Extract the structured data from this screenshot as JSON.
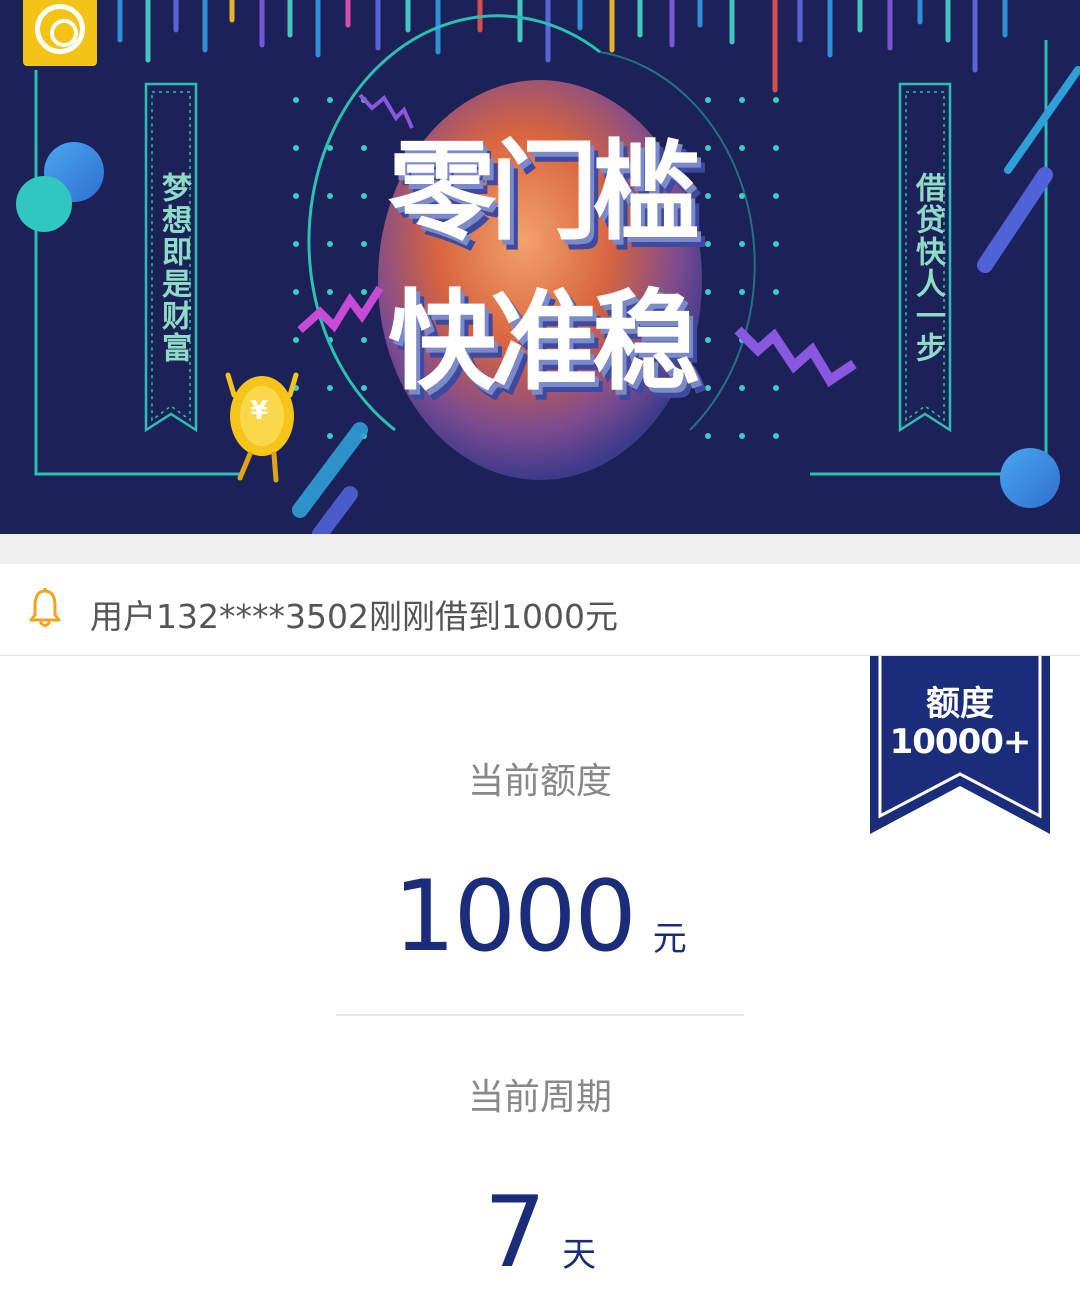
{
  "banner": {
    "side_left": "梦想即是财富",
    "side_right": "借贷快人一步",
    "headline_line1": "零门槛",
    "headline_line2": "快准稳",
    "coin_symbol": "¥"
  },
  "notice": {
    "text": "用户132****3502刚刚借到1000元",
    "icon": "bell-icon"
  },
  "ribbon": {
    "line1": "额度",
    "line2": "10000+"
  },
  "quota": {
    "label": "当前额度",
    "value": "1000",
    "unit": "元"
  },
  "period": {
    "label": "当前周期",
    "value": "7",
    "unit": "天"
  },
  "colors": {
    "banner_bg": "#1c2157",
    "brand_blue": "#1b2d7a",
    "accent_teal": "#2bc0b5",
    "bell_orange": "#f4a21a",
    "label_gray": "#888888"
  }
}
